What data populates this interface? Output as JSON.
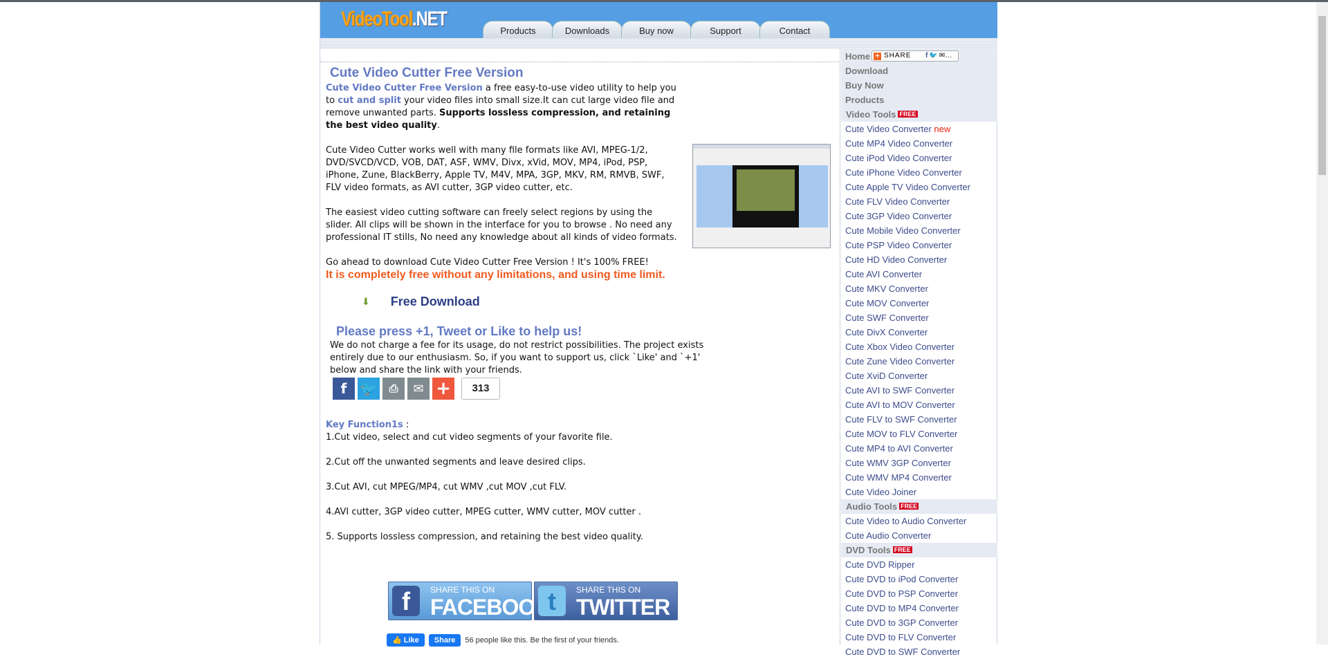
{
  "header": {
    "logo_main": "VideoTool",
    "logo_suffix": ".NET",
    "tabs": [
      "Products",
      "Downloads",
      "Buy now",
      "Support",
      "Contact"
    ]
  },
  "main": {
    "title": "Cute Video Cutter Free Version",
    "intro": {
      "link1": "Cute Video Cutter Free Version",
      "t1": " a free easy-to-use video utility to help you to ",
      "link2": "cut and split",
      "t2": " your video files into small size.It can cut large video file and remove unwanted parts. ",
      "bold": "Supports lossless compression, and retaining the best video quality",
      "t3": "."
    },
    "formats": "Cute Video Cutter works well with many file formats like AVI, MPEG-1/2, DVD/SVCD/VCD, VOB, DAT, ASF, WMV, Divx, xVid, MOV, MP4, iPod, PSP, iPhone, Zune, BlackBerry, Apple TV, M4V, MPA, 3GP, MKV, RM, RMVB, SWF, FLV video formats, as AVI cutter, 3GP video cutter, etc.",
    "easiest": "The easiest video cutting software can freely select regions by using the slider. All clips will be shown in the interface for you to browse . No need any professional IT stills, No need any knowledge about all kinds of video formats.",
    "goahead": "Go ahead to download Cute Video Cutter Free Version ! It's 100% FREE!",
    "free_notice": "It is completely free without any limitations, and using time limit.",
    "download_label": "Free Download",
    "please": "Please press +1, Tweet or Like to help us!",
    "support_text": "We do not charge a fee for its usage, do not restrict possibilities. The project exists entirely due to our enthusiasm. So, if you want to support us, click `Like' and `+1' below and share the link with your friends.",
    "share_count": "313",
    "key_title": "Key Function1s",
    "key_colon": " :",
    "functions": [
      "1.Cut video, select and cut video segments of your favorite file.",
      "2.Cut off the unwanted segments and leave desired clips.",
      "3.Cut AVI, cut MPEG/MP4, cut WMV ,cut MOV ,cut FLV.",
      "4.AVI cutter, 3GP video cutter, MPEG cutter, WMV cutter, MOV cutter .",
      "5. Supports lossless compression, and retaining the best video quality."
    ],
    "share_fb": {
      "small": "SHARE THIS ON",
      "big": "FACEBOOK"
    },
    "share_tw": {
      "small": "SHARE THIS ON",
      "big": "TWITTER"
    },
    "fb_like": "Like",
    "fb_share": "Share",
    "fb_text": "56 people like this. Be the first of your friends."
  },
  "sidebar": {
    "top": [
      "Home",
      "Download",
      "Buy Now",
      "Products"
    ],
    "share_label": "SHARE",
    "free_badge": "FREE",
    "new_badge": "new",
    "video_tools": "Video Tools",
    "video_items": [
      "Cute Video Converter",
      "Cute MP4 Video Converter",
      "Cute iPod Video Converter",
      "Cute iPhone Video Converter",
      "Cute Apple TV Video Converter",
      "Cute FLV Video Converter",
      "Cute 3GP Video Converter",
      "Cute Mobile Video Converter",
      "Cute PSP Video Converter",
      "Cute HD Video Converter",
      "Cute AVI Converter",
      "Cute MKV Converter",
      "Cute MOV Converter",
      "Cute SWF Converter",
      "Cute DivX Converter",
      "Cute Xbox Video Converter",
      "Cute Zune Video Converter",
      "Cute XviD Converter",
      "Cute AVI to SWF Converter",
      "Cute AVI to MOV Converter",
      "Cute FLV to SWF Converter",
      "Cute MOV to FLV Converter",
      "Cute MP4 to AVI Converter",
      "Cute WMV 3GP Converter",
      "Cute WMV MP4 Converter",
      "Cute Video Joiner"
    ],
    "audio_tools": "Audio Tools",
    "audio_items": [
      "Cute Video to Audio Converter",
      "Cute Audio Converter"
    ],
    "dvd_tools": "DVD Tools",
    "dvd_items": [
      "Cute DVD Ripper",
      "Cute DVD to iPod Converter",
      "Cute DVD to PSP Converter",
      "Cute DVD to MP4 Converter",
      "Cute DVD to 3GP Converter",
      "Cute DVD to FLV Converter",
      "Cute DVD to SWF Converter"
    ]
  }
}
